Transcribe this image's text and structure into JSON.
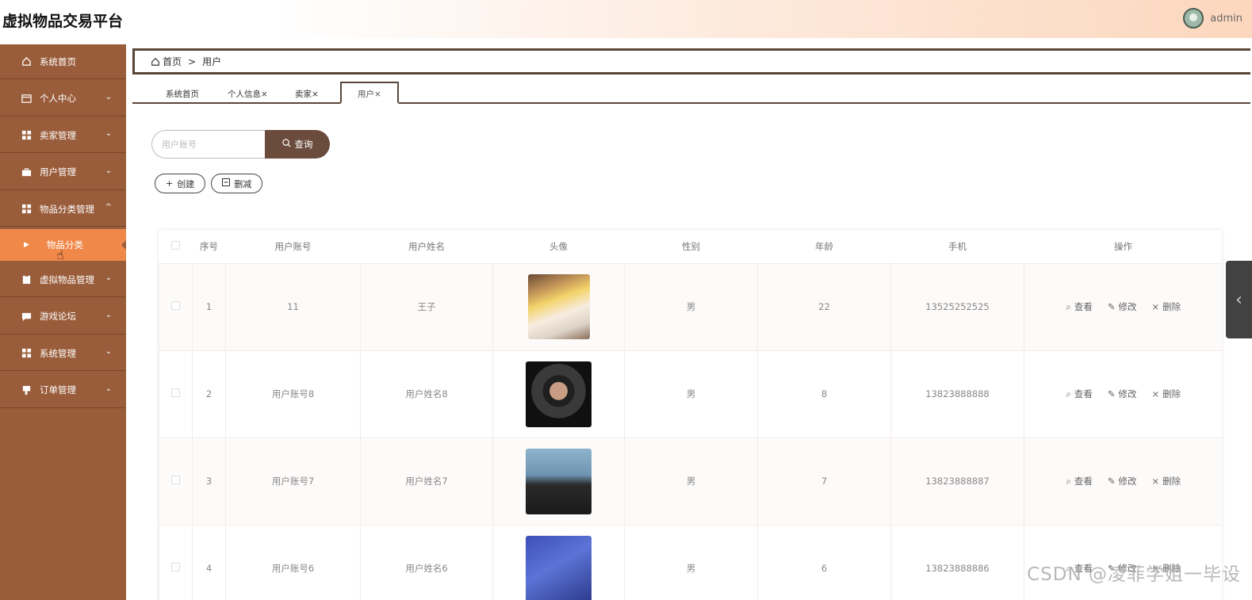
{
  "app": {
    "title": "虚拟物品交易平台",
    "user": "admin"
  },
  "sidebar": {
    "items": [
      {
        "label": "系统首页",
        "icon": "home-icon",
        "chevron": ""
      },
      {
        "label": "个人中心",
        "icon": "card-icon",
        "chevron": "⌄"
      },
      {
        "label": "卖家管理",
        "icon": "grid-icon",
        "chevron": "⌄"
      },
      {
        "label": "用户管理",
        "icon": "briefcase-icon",
        "chevron": "⌄"
      },
      {
        "label": "物品分类管理",
        "icon": "grid-icon",
        "chevron": "^"
      },
      {
        "label": "虚拟物品管理",
        "icon": "clipboard-icon",
        "chevron": "⌄"
      },
      {
        "label": "游戏论坛",
        "icon": "chat-icon",
        "chevron": "⌄"
      },
      {
        "label": "系统管理",
        "icon": "grid-icon",
        "chevron": "⌄"
      },
      {
        "label": "订单管理",
        "icon": "flag-icon",
        "chevron": "⌄"
      }
    ],
    "active_sub": "物品分类"
  },
  "breadcrumb": {
    "home": "首页",
    "separator": ">",
    "current": "用户"
  },
  "tabs": [
    {
      "label": "系统首页"
    },
    {
      "label": "个人信息×"
    },
    {
      "label": "卖家×"
    },
    {
      "label": "用户×"
    }
  ],
  "search": {
    "placeholder": "用户账号",
    "button": "查询"
  },
  "actions": {
    "create": "创建",
    "delete": "删减"
  },
  "table": {
    "columns": [
      "序号",
      "用户账号",
      "用户姓名",
      "头像",
      "性别",
      "年龄",
      "手机",
      "操作"
    ],
    "rows": [
      {
        "no": "1",
        "account": "11",
        "name": "王子",
        "gender": "男",
        "age": "22",
        "phone": "13525252525"
      },
      {
        "no": "2",
        "account": "用户账号8",
        "name": "用户姓名8",
        "gender": "男",
        "age": "8",
        "phone": "13823888888"
      },
      {
        "no": "3",
        "account": "用户账号7",
        "name": "用户姓名7",
        "gender": "男",
        "age": "7",
        "phone": "13823888887"
      },
      {
        "no": "4",
        "account": "用户账号6",
        "name": "用户姓名6",
        "gender": "男",
        "age": "6",
        "phone": "13823888886"
      }
    ],
    "ops": {
      "view": "查看",
      "edit": "修改",
      "delete": "删除"
    }
  },
  "watermark": "CSDN @凌菲学姐一毕设",
  "colors": {
    "sidebar": "#9a5d3b",
    "active": "#f0884a",
    "accent": "#6b4b3c"
  }
}
